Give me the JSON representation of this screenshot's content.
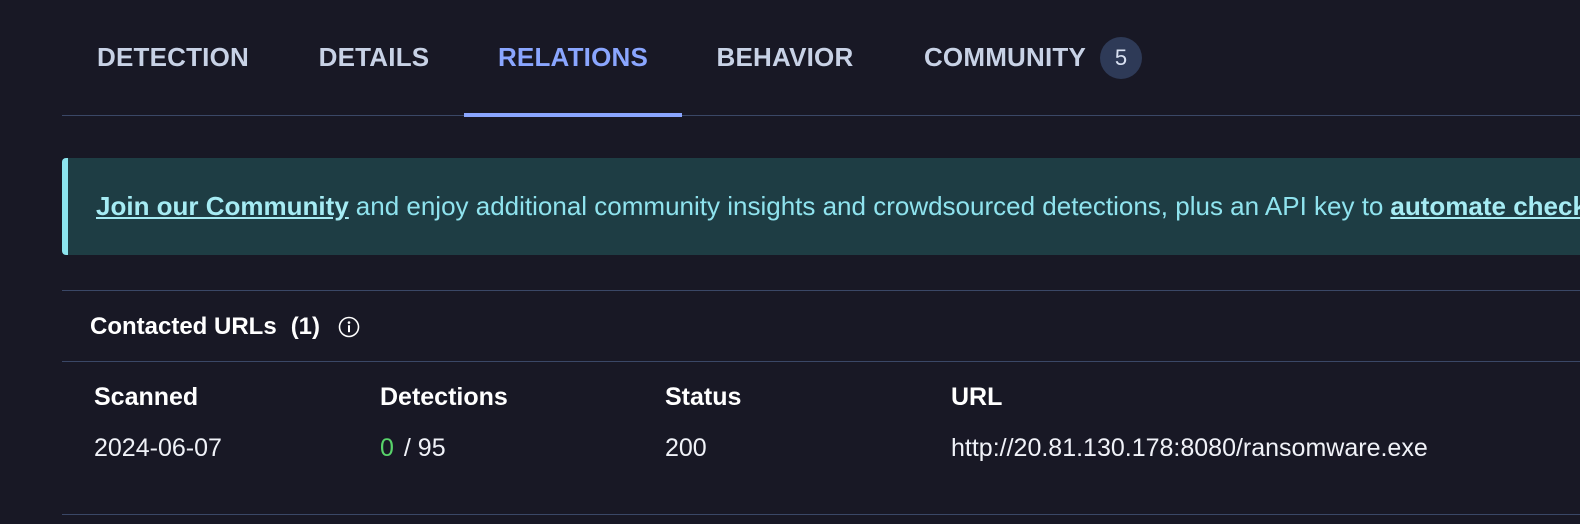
{
  "tabs": [
    {
      "label": "DETECTION"
    },
    {
      "label": "DETAILS"
    },
    {
      "label": "RELATIONS",
      "active": true
    },
    {
      "label": "BEHAVIOR"
    },
    {
      "label": "COMMUNITY",
      "badge": "5"
    }
  ],
  "banner": {
    "link_text": "Join our Community",
    "middle_text": "and enjoy additional community insights and crowdsourced detections, plus an API key to",
    "link2_text": "automate checks."
  },
  "section": {
    "title": "Contacted URLs",
    "count": "(1)",
    "info_icon": "info-circle-icon"
  },
  "table": {
    "headers": [
      "Scanned",
      "Detections",
      "Status",
      "URL"
    ],
    "rows": [
      {
        "scanned": "2024-06-07",
        "detections_positive": "0",
        "detections_total": "/ 95",
        "status": "200",
        "url": "http://20.81.130.178:8080/ransomware.exe"
      }
    ]
  },
  "colors": {
    "background": "#181825",
    "tab_active": "#8aa6ff",
    "banner_bg": "#1e3d44",
    "banner_text": "#8fe3ee",
    "detection_zero": "#58d36a"
  }
}
